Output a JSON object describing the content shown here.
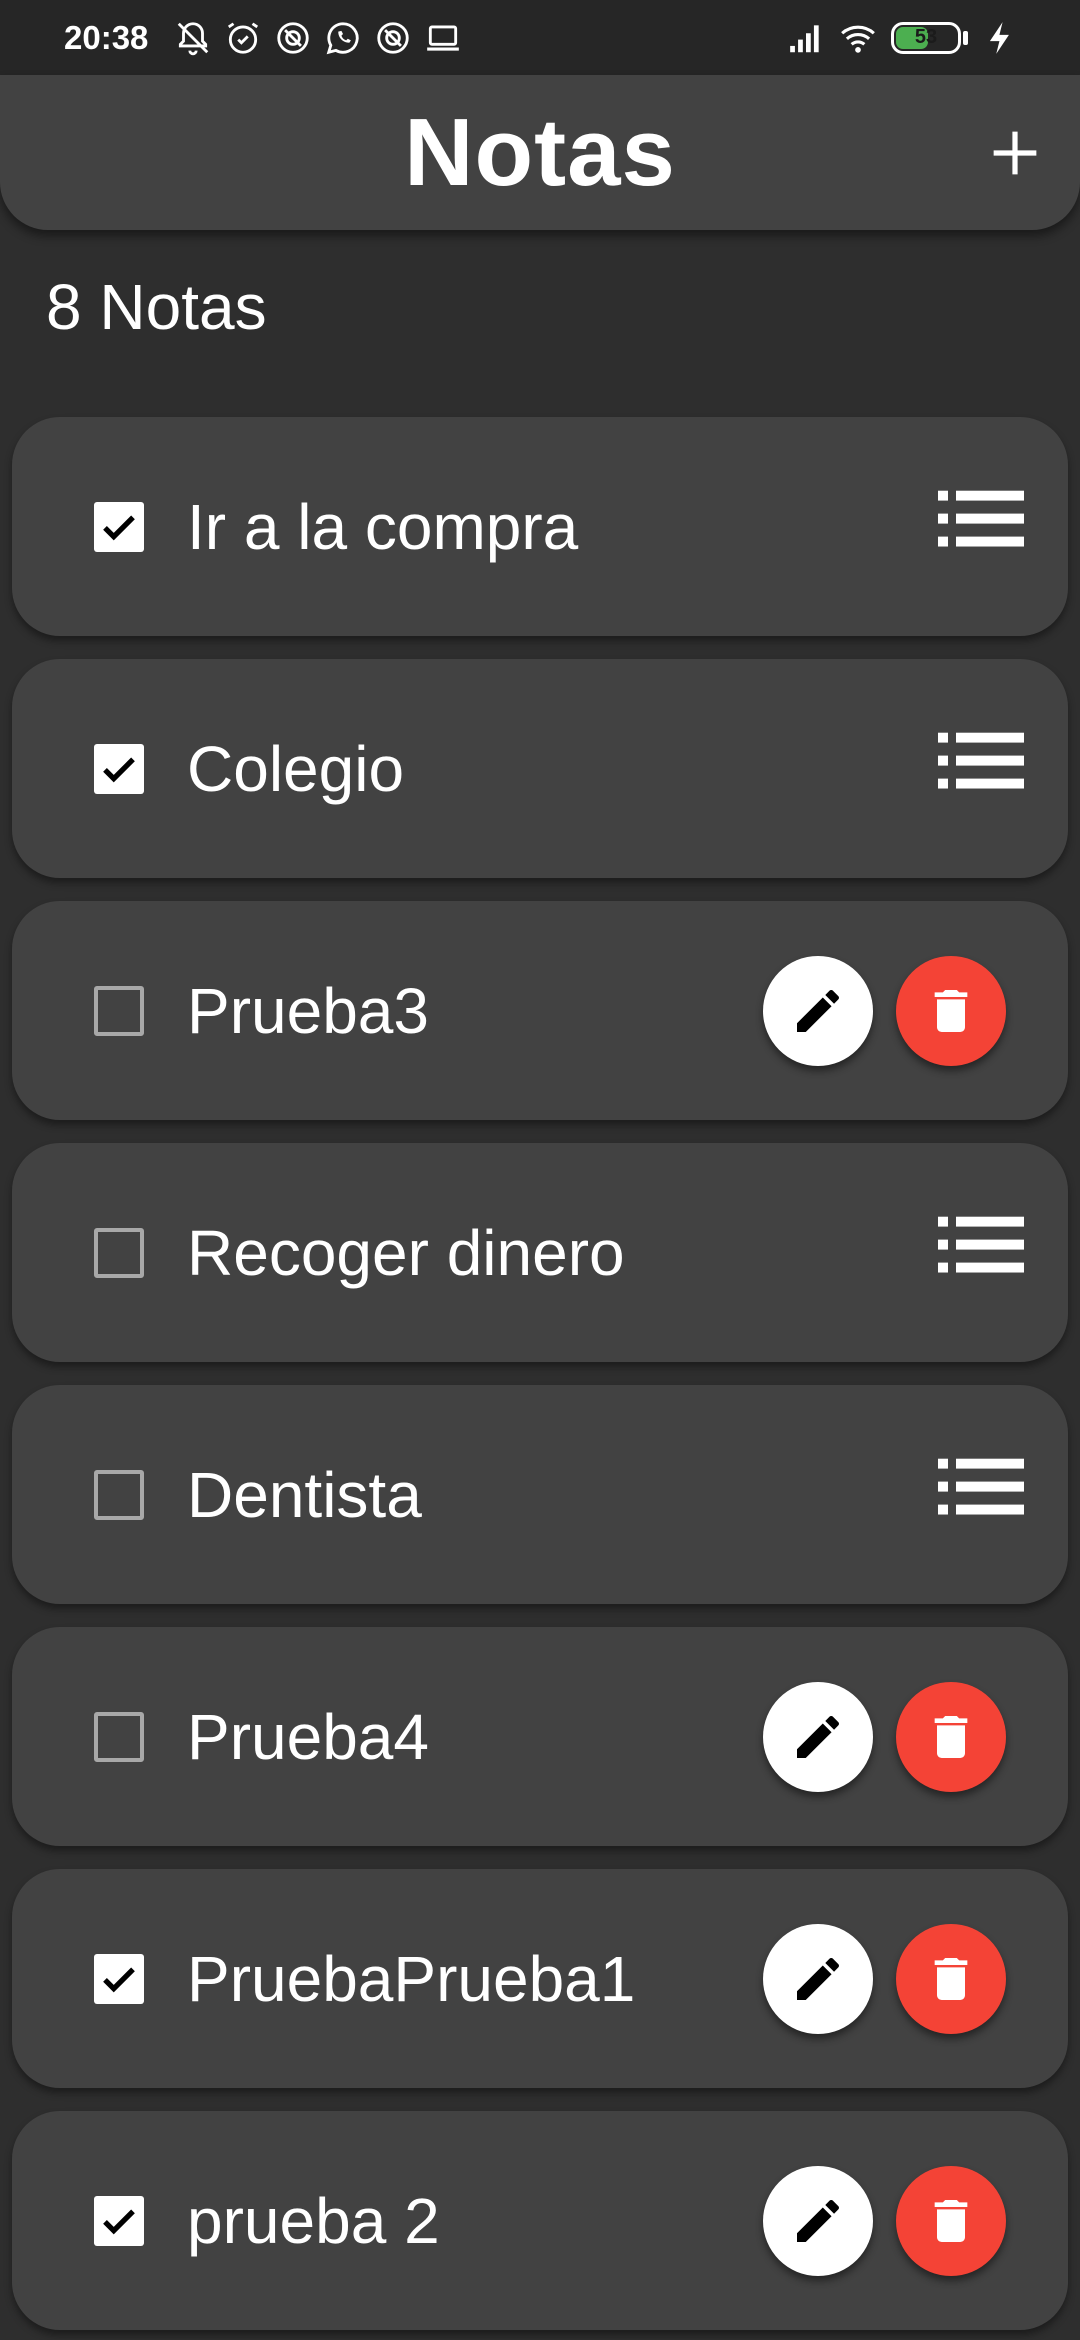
{
  "status_bar": {
    "time": "20:38",
    "icons": [
      "bell-off-icon",
      "alarm-icon",
      "app-notification-icon",
      "whatsapp-icon",
      "app-notification-icon",
      "laptop-icon"
    ],
    "battery_level": "53",
    "battery_color": "#4caf50"
  },
  "app_bar": {
    "title": "Notas",
    "add_icon": "plus-icon"
  },
  "notes_count": "8 Notas",
  "colors": {
    "background": "#2e2e2e",
    "card": "#424242",
    "delete": "#f44336",
    "edit": "#ffffff"
  },
  "notes": [
    {
      "title": "Ir a la compra",
      "checked": true,
      "actions": "list"
    },
    {
      "title": "Colegio",
      "checked": true,
      "actions": "list"
    },
    {
      "title": "Prueba3",
      "checked": false,
      "actions": "edit-delete"
    },
    {
      "title": "Recoger dinero",
      "checked": false,
      "actions": "list"
    },
    {
      "title": "Dentista",
      "checked": false,
      "actions": "list"
    },
    {
      "title": "Prueba4",
      "checked": false,
      "actions": "edit-delete"
    },
    {
      "title": "PruebaPrueba1",
      "checked": true,
      "actions": "edit-delete"
    },
    {
      "title": "prueba 2",
      "checked": true,
      "actions": "edit-delete"
    }
  ]
}
